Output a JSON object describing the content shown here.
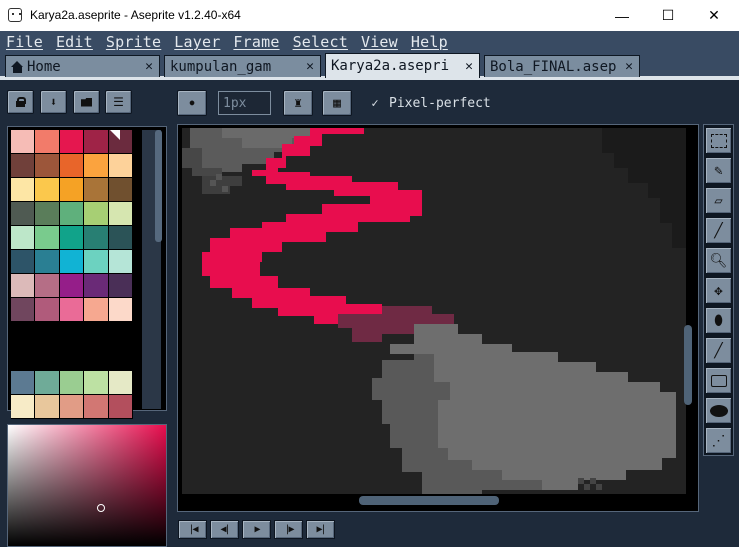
{
  "window": {
    "title": "Karya2a.aseprite - Aseprite v1.2.40-x64",
    "minimize": "—",
    "maximize": "☐",
    "close": "✕"
  },
  "menu": [
    "File",
    "Edit",
    "Sprite",
    "Layer",
    "Frame",
    "Select",
    "View",
    "Help"
  ],
  "tabs": [
    {
      "label": "Home",
      "icon": "home-icon",
      "close": "✕"
    },
    {
      "label": "kumpulan_gam",
      "close": "✕"
    },
    {
      "label": "Karya2a.asepri",
      "close": "✕",
      "active": true
    },
    {
      "label": "Bola_FINAL.asep",
      "close": "✕"
    }
  ],
  "toolbar": {
    "brush_size": "1px",
    "pixel_perfect_label": "Pixel-perfect",
    "pixel_perfect_checked": "✓"
  },
  "palette": {
    "rows": [
      [
        "#f6bcb6",
        "#f27b6a",
        "#e5174f",
        "#9f2347",
        "#6b2b3e"
      ],
      [
        "#70403a",
        "#9c563a",
        "#e8652a",
        "#fba33e",
        "#fdd29a"
      ],
      [
        "#fde6a5",
        "#fbc84c",
        "#f5a225",
        "#a97438",
        "#70502f"
      ],
      [
        "#4f5a52",
        "#5a7d5a",
        "#5fb07c",
        "#a7cf74",
        "#d6e6b0"
      ],
      [
        "#bde7c9",
        "#79cb8d",
        "#11a38a",
        "#287f73",
        "#2b5357"
      ],
      [
        "#2d5468",
        "#2a7f93",
        "#11b3d4",
        "#6cd2c0",
        "#b5e5d7"
      ],
      [
        "#dcbab9",
        "#b56e86",
        "#951e89",
        "#6a2a77",
        "#4a2f57"
      ],
      [
        "#70465e",
        "#b05b7b",
        "#ea6b97",
        "#f6a890",
        "#fcd9c9"
      ]
    ],
    "rows_lower": [
      [
        "#5c7a92",
        "#6fab98",
        "#9acd91",
        "#bde1a3",
        "#e5e9c6"
      ],
      [
        "#f7ebc7",
        "#e8c79c",
        "#e19c86",
        "#d27773",
        "#b34f5d"
      ]
    ],
    "primary_color": "#e80d4e"
  },
  "colors": {
    "background": "#232323",
    "stroke": "#e80d4e",
    "stroke_dark": "#6f2a44",
    "shadow_light": "#6e6e6e",
    "shadow_mid": "#595959",
    "shadow_dark": "#3e3e3e"
  },
  "nav": [
    "|◀",
    "◀|",
    "▶",
    "|▶",
    "▶|"
  ]
}
